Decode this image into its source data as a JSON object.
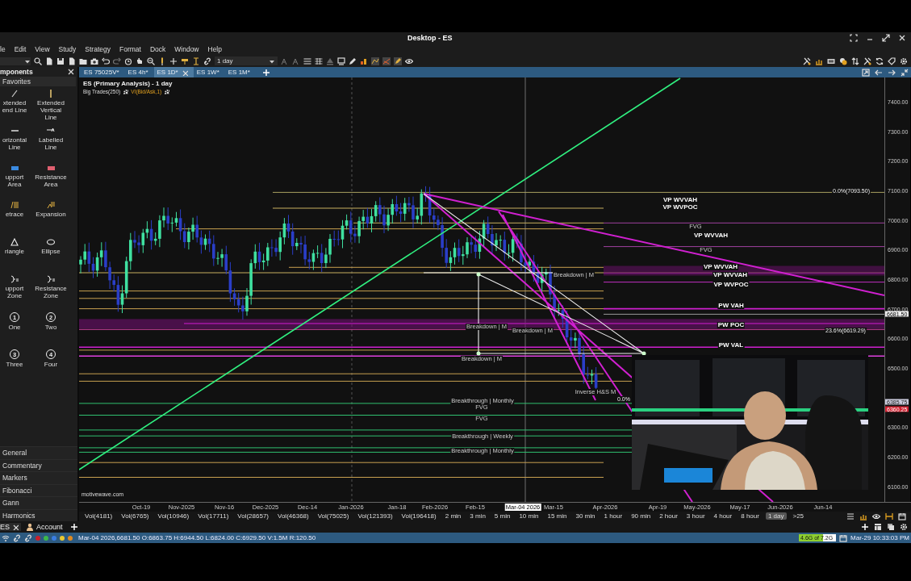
{
  "window": {
    "title": "Desktop - ES"
  },
  "menu": [
    "le",
    "Edit",
    "View",
    "Study",
    "Strategy",
    "Format",
    "Dock",
    "Window",
    "Help"
  ],
  "toolbar": {
    "timeframe": "1 day"
  },
  "components_panel": {
    "title": "mponents",
    "favorites": "Favorites",
    "tools": [
      {
        "lines": [
          "xtended",
          "end Line"
        ]
      },
      {
        "lines": [
          "Extended",
          "Vertical",
          "Line"
        ]
      },
      {
        "lines": [
          "orizontal",
          "Line"
        ]
      },
      {
        "lines": [
          "Labelled",
          "Line"
        ]
      },
      {
        "lines": [
          "upport",
          "Area"
        ]
      },
      {
        "lines": [
          "Resistance",
          "Area"
        ]
      },
      {
        "lines": [
          "etrace"
        ]
      },
      {
        "lines": [
          "Expansion"
        ]
      },
      {
        "lines": [
          "riangle"
        ]
      },
      {
        "lines": [
          "Ellipse"
        ]
      },
      {
        "lines": [
          "upport",
          "Zone"
        ]
      },
      {
        "lines": [
          "Resistance",
          "Zone"
        ]
      },
      {
        "badge": "1",
        "lines": [
          "One"
        ]
      },
      {
        "badge": "2",
        "lines": [
          "Two"
        ]
      },
      {
        "badge": "3",
        "lines": [
          "Three"
        ]
      },
      {
        "badge": "4",
        "lines": [
          "Four"
        ]
      }
    ],
    "categories": [
      "General",
      "Commentary",
      "Markers",
      "Fibonacci",
      "Gann",
      "Harmonics"
    ]
  },
  "chart_tabs": [
    {
      "label": "ES 75025V*",
      "selected": false
    },
    {
      "label": "ES 4h*",
      "selected": false
    },
    {
      "label": "ES 1D*",
      "selected": true
    },
    {
      "label": "ES 1W*",
      "selected": false
    },
    {
      "label": "ES 1M*",
      "selected": false
    }
  ],
  "chart": {
    "title": "ES (Primary Analysis) - 1 day",
    "studies": [
      {
        "label": "Big Trades(250)",
        "kind": "plain"
      },
      {
        "label": "VI(Bid/Ask,1)",
        "kind": "accent"
      }
    ],
    "annotations": [
      {
        "text": "0.0%(7093.50)",
        "kind": "fib"
      },
      {
        "text": "VP WVVAH",
        "kind": "level"
      },
      {
        "text": "VP WVPOC",
        "kind": "level"
      },
      {
        "text": "FVG",
        "kind": "note"
      },
      {
        "text": "VP WVVAH",
        "kind": "level"
      },
      {
        "text": "FVG",
        "kind": "note"
      },
      {
        "text": "VP WVVAH",
        "kind": "level"
      },
      {
        "text": "VP WVVAH",
        "kind": "level"
      },
      {
        "text": "VP WVPOC",
        "kind": "level"
      },
      {
        "text": "PW VAH",
        "kind": "level"
      },
      {
        "text": "PW POC",
        "kind": "level"
      },
      {
        "text": "23.6%(6619.29)",
        "kind": "fib"
      },
      {
        "text": "PW VAL",
        "kind": "level"
      },
      {
        "text": "Breakdown | M",
        "kind": "note"
      },
      {
        "text": "Breakdown | M",
        "kind": "note"
      },
      {
        "text": "Breakdown | M",
        "kind": "note"
      },
      {
        "text": "Breakdown | M",
        "kind": "note"
      },
      {
        "text": "Inverse H&S M",
        "kind": "note"
      },
      {
        "text": "0.0%",
        "kind": "fib"
      },
      {
        "text": "Breakthrough | Monthly",
        "kind": "note"
      },
      {
        "text": "FVG",
        "kind": "note"
      },
      {
        "text": "FVG",
        "kind": "note"
      },
      {
        "text": "Breakthrough | Weekly",
        "kind": "note"
      },
      {
        "text": "Breakthrough | Monthly",
        "kind": "note"
      },
      {
        "text": "motivewave.com",
        "kind": "credit"
      }
    ],
    "y_axis": [
      "7400.00",
      "7300.00",
      "7200.00",
      "7100.00",
      "7000.00",
      "6900.00",
      "6800.00",
      "6700.00",
      "6600.00",
      "6500.00",
      "6300.00",
      "6200.00",
      "6100.00"
    ],
    "price_tags": [
      {
        "text": "6681.50",
        "kind": "last"
      },
      {
        "text": "6385.75",
        "kind": "marker"
      },
      {
        "text": "6360.25",
        "kind": "alert"
      }
    ],
    "x_axis": [
      {
        "label": "Oct-19",
        "selected": false
      },
      {
        "label": "Nov-2025",
        "selected": false
      },
      {
        "label": "Nov-16",
        "selected": false
      },
      {
        "label": "Dec-2025",
        "selected": false
      },
      {
        "label": "Dec-14",
        "selected": false
      },
      {
        "label": "Jan-2026",
        "selected": false
      },
      {
        "label": "Jan-18",
        "selected": false
      },
      {
        "label": "Feb-2026",
        "selected": false
      },
      {
        "label": "Feb-15",
        "selected": false
      },
      {
        "label": "Mar-04 2026",
        "selected": true
      },
      {
        "label": "Mar-15",
        "selected": false
      },
      {
        "label": "Apr-2026",
        "selected": false
      },
      {
        "label": "Apr-19",
        "selected": false
      },
      {
        "label": "May-2026",
        "selected": false
      },
      {
        "label": "May-17",
        "selected": false
      },
      {
        "label": "Jun-2026",
        "selected": false
      },
      {
        "label": "Jun-14",
        "selected": false
      }
    ]
  },
  "timeframes": [
    {
      "label": "Vol(4181)",
      "selected": false
    },
    {
      "label": "Vol(6765)",
      "selected": false
    },
    {
      "label": "Vol(10946)",
      "selected": false
    },
    {
      "label": "Vol(17711)",
      "selected": false
    },
    {
      "label": "Vol(28657)",
      "selected": false
    },
    {
      "label": "Vol(46368)",
      "selected": false
    },
    {
      "label": "Vol(75025)",
      "selected": false
    },
    {
      "label": "Vol(121393)",
      "selected": false
    },
    {
      "label": "Vol(196418)",
      "selected": false
    },
    {
      "label": "2 min",
      "selected": false
    },
    {
      "label": "3 min",
      "selected": false
    },
    {
      "label": "5 min",
      "selected": false
    },
    {
      "label": "10 min",
      "selected": false
    },
    {
      "label": "15 min",
      "selected": false
    },
    {
      "label": "30 min",
      "selected": false
    },
    {
      "label": "1 hour",
      "selected": false
    },
    {
      "label": "90 min",
      "selected": false
    },
    {
      "label": "2 hour",
      "selected": false
    },
    {
      "label": "3 hour",
      "selected": false
    },
    {
      "label": "4 hour",
      "selected": false
    },
    {
      "label": "8 hour",
      "selected": false
    },
    {
      "label": "1 day",
      "selected": true
    },
    {
      "label": ">25",
      "selected": false
    }
  ],
  "panel_tabs": [
    {
      "label": "ES",
      "kind": "closable"
    },
    {
      "label": "Account",
      "kind": "account"
    }
  ],
  "status_bar": {
    "dots": [
      {
        "color": "#c8202c"
      },
      {
        "color": "#3cb84a"
      },
      {
        "color": "#3a7de0"
      },
      {
        "color": "#e8c830"
      },
      {
        "color": "#e08a20"
      }
    ],
    "quote": "Mar-04 2026,6681.50 O:6863.75 H:6944.50 L:6824.00 C:6929.50 V:1.5M R:120.50",
    "memory": {
      "text": "4.6G of 7.2G",
      "level": 0.64
    },
    "clock": "Mar-29 10:33:03 PM"
  }
}
